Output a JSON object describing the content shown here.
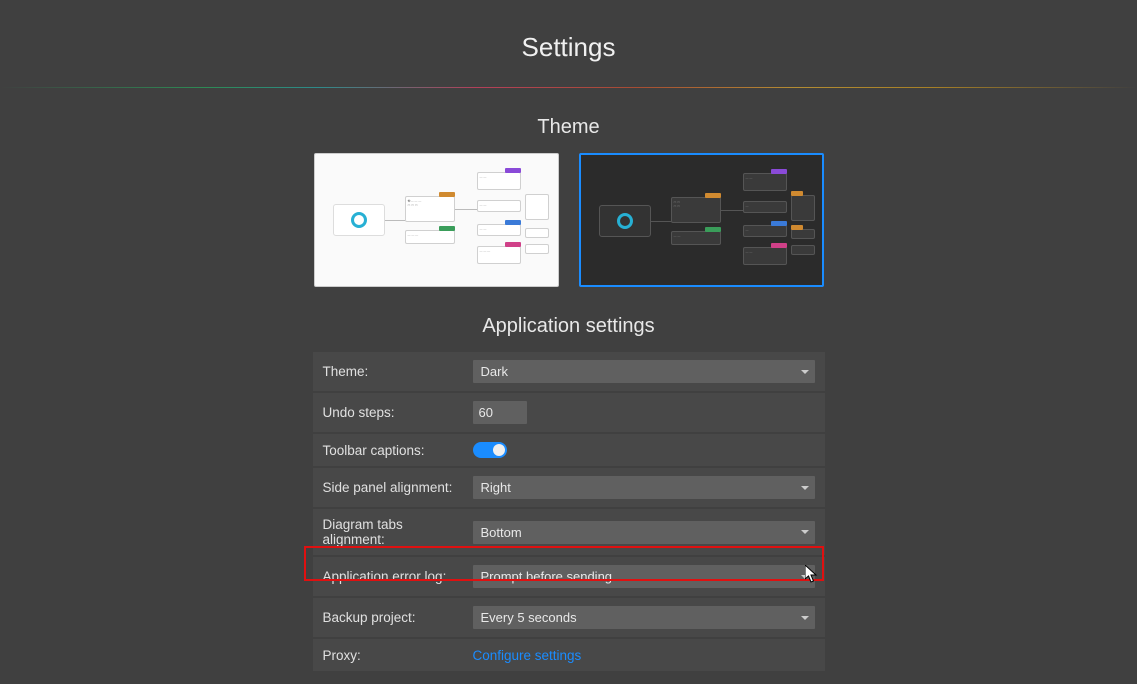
{
  "page_title": "Settings",
  "sections": {
    "theme": {
      "title": "Theme"
    },
    "app": {
      "title": "Application settings",
      "rows": {
        "theme": {
          "label": "Theme:",
          "value": "Dark"
        },
        "undo": {
          "label": "Undo steps:",
          "value": "60"
        },
        "captions": {
          "label": "Toolbar captions:",
          "value": true
        },
        "side": {
          "label": "Side panel alignment:",
          "value": "Right"
        },
        "tabs": {
          "label": "Diagram tabs alignment:",
          "value": "Bottom"
        },
        "errlog": {
          "label": "Application error log:",
          "value": "Prompt before sending"
        },
        "backup": {
          "label": "Backup project:",
          "value": "Every 5 seconds"
        },
        "proxy": {
          "label": "Proxy:",
          "link": "Configure settings"
        }
      }
    }
  }
}
